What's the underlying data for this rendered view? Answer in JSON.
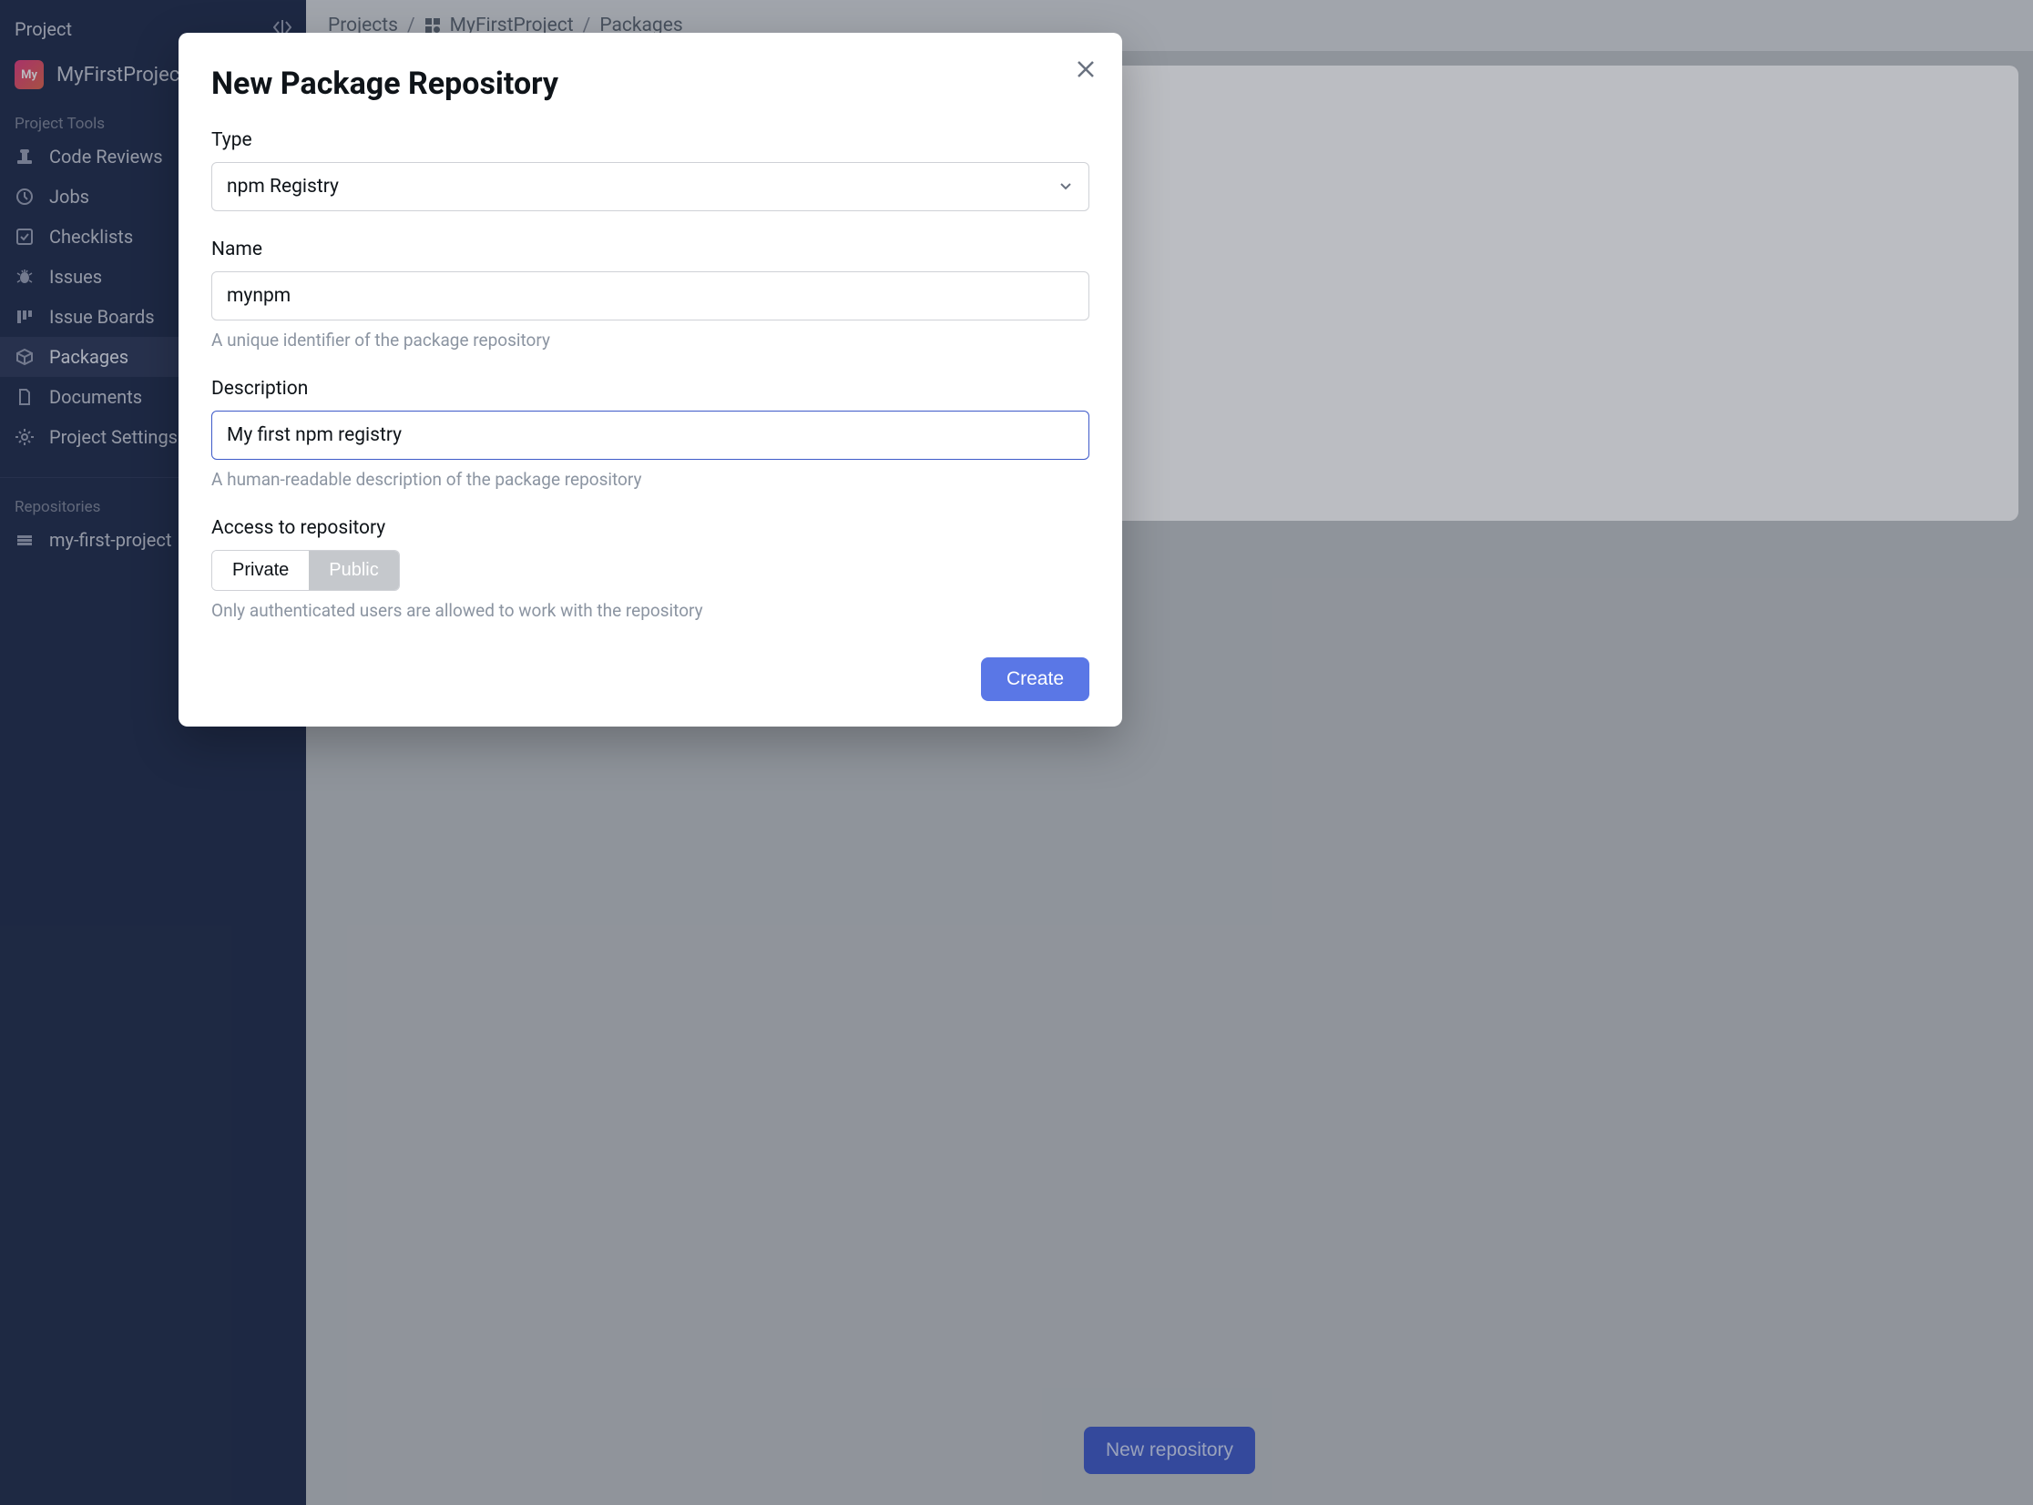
{
  "sidebar": {
    "header": "Project",
    "project": {
      "avatar": "My",
      "name": "MyFirstProject"
    },
    "sections": [
      {
        "label": "Project Tools",
        "items": [
          {
            "id": "code-reviews",
            "label": "Code Reviews",
            "icon": "stamp-icon"
          },
          {
            "id": "jobs",
            "label": "Jobs",
            "icon": "clock-icon"
          },
          {
            "id": "checklists",
            "label": "Checklists",
            "icon": "checklist-icon"
          },
          {
            "id": "issues",
            "label": "Issues",
            "icon": "bug-icon"
          },
          {
            "id": "issue-boards",
            "label": "Issue Boards",
            "icon": "board-icon"
          },
          {
            "id": "packages",
            "label": "Packages",
            "icon": "package-icon",
            "active": true
          },
          {
            "id": "documents",
            "label": "Documents",
            "icon": "document-icon"
          },
          {
            "id": "settings",
            "label": "Project Settings",
            "icon": "gear-icon"
          }
        ]
      },
      {
        "label": "Repositories",
        "items": [
          {
            "id": "repo-0",
            "label": "my-first-project",
            "icon": "repo-icon"
          }
        ]
      }
    ]
  },
  "breadcrumb": {
    "parts": [
      "Projects",
      "MyFirstProject",
      "Packages"
    ]
  },
  "page": {
    "new_repo_button": "New repository"
  },
  "modal": {
    "title": "New Package Repository",
    "type": {
      "label": "Type",
      "value": "npm Registry"
    },
    "name": {
      "label": "Name",
      "value": "mynpm",
      "help": "A unique identifier of the package repository"
    },
    "description": {
      "label": "Description",
      "value": "My first npm registry",
      "help": "A human-readable description of the package repository"
    },
    "access": {
      "label": "Access to repository",
      "options": [
        "Private",
        "Public"
      ],
      "selected": "Private",
      "help": "Only authenticated users are allowed to work with the repository"
    },
    "create_button": "Create"
  }
}
